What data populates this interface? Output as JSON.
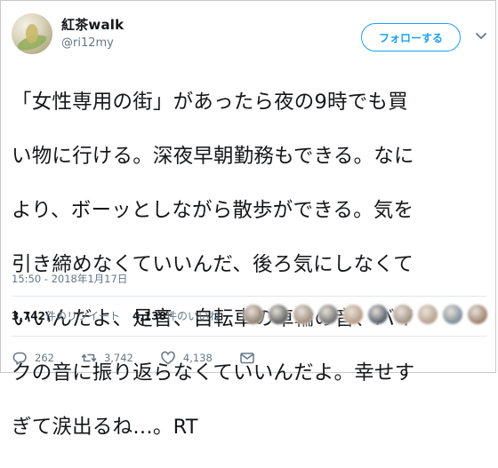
{
  "user": {
    "display_name": "紅茶walk",
    "handle": "@ri12my"
  },
  "follow_button_label": "フォローする",
  "tweet": {
    "text_lines": [
      "「女性専用の街」があったら夜の9時でも買",
      "い物に行ける。深夜早朝勤務もできる。なに",
      "より、ボーッとしながら散歩ができる。気を",
      "引き締めなくていいんだ、後ろ気にしなくて",
      "いいんだよ、足音、自転車の車輪の音、バイ",
      "クの音に振り返らなくていいんだよ。幸せす",
      "ぎて涙出るね…。RT"
    ],
    "timestamp": "15:50 - 2018年1月17日"
  },
  "stats": {
    "retweets_count": "3,742",
    "retweets_label": "件のリツイート",
    "likes_count": "4,138",
    "likes_label": "件のいいね"
  },
  "likers": {
    "count": 10,
    "colors": [
      "#8b7b6b",
      "#5c5c5c",
      "#9c8a7a",
      "#6e6e6e",
      "#b59a84",
      "#4f5a66",
      "#a08f80",
      "#b4a08a",
      "#7a8b99",
      "#9a7f6b"
    ]
  },
  "actions": {
    "reply_count": "262",
    "retweet_count": "3,742",
    "like_count": "4,138"
  },
  "icons": {
    "chevron": "chevron-down-icon",
    "reply": "reply-icon",
    "retweet": "retweet-icon",
    "like": "heart-icon",
    "dm": "envelope-icon"
  },
  "colors": {
    "accent": "#1da1f2",
    "secondary_text": "#657786",
    "text": "#14171a"
  }
}
